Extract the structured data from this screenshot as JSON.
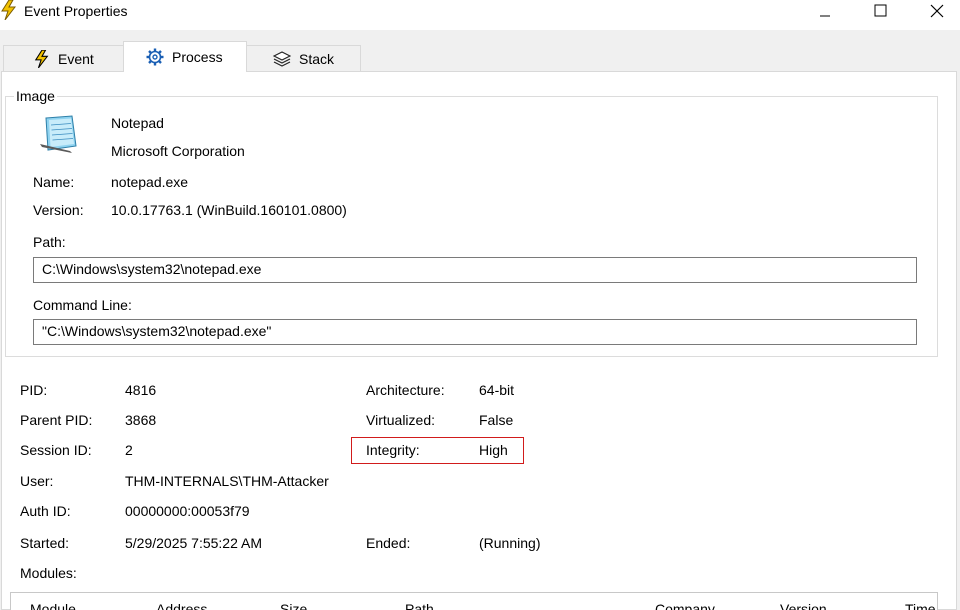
{
  "window": {
    "title": "Event Properties",
    "icon": "lightning-icon"
  },
  "tabs": [
    {
      "label": "Event",
      "icon": "lightning-icon",
      "selected": false
    },
    {
      "label": "Process",
      "icon": "gear-icon",
      "selected": true
    },
    {
      "label": "Stack",
      "icon": "stack-icon",
      "selected": false
    }
  ],
  "image": {
    "group_label": "Image",
    "app_icon": "notepad-icon",
    "product": "Notepad",
    "company": "Microsoft Corporation",
    "name_label": "Name:",
    "name": "notepad.exe",
    "version_label": "Version:",
    "version": "10.0.17763.1 (WinBuild.160101.0800)",
    "path_label": "Path:",
    "path": "C:\\Windows\\system32\\notepad.exe",
    "command_line_label": "Command Line:",
    "command_line": "\"C:\\Windows\\system32\\notepad.exe\""
  },
  "process": {
    "pid_label": "PID:",
    "pid": "4816",
    "parent_pid_label": "Parent PID:",
    "parent_pid": "3868",
    "session_id_label": "Session ID:",
    "session_id": "2",
    "user_label": "User:",
    "user": "THM-INTERNALS\\THM-Attacker",
    "auth_id_label": "Auth ID:",
    "auth_id": "00000000:00053f79",
    "started_label": "Started:",
    "started": "5/29/2025 7:55:22 AM",
    "architecture_label": "Architecture:",
    "architecture": "64-bit",
    "virtualized_label": "Virtualized:",
    "virtualized": "False",
    "integrity_label": "Integrity:",
    "integrity": "High",
    "ended_label": "Ended:",
    "ended": "(Running)",
    "modules_label": "Modules:"
  },
  "modules_table": {
    "columns": [
      "Module",
      "Address",
      "Size",
      "Path",
      "Company",
      "Version",
      "Time"
    ]
  },
  "colors": {
    "highlight_border": "#d11b1b",
    "accent_blue": "#1a5fb4"
  }
}
